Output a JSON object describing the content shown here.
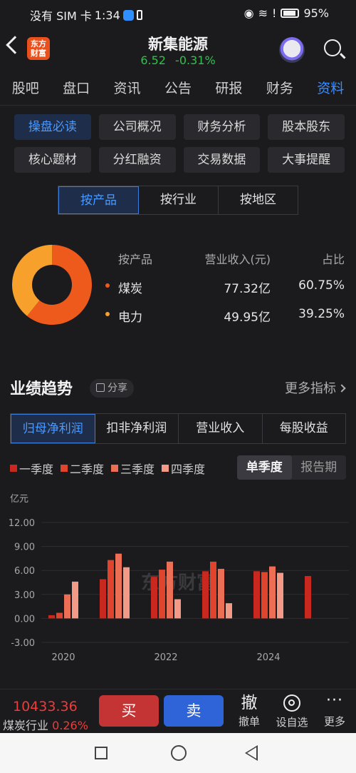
{
  "status": {
    "carrier": "没有 SIM 卡",
    "time": "1:34",
    "battery": "95%"
  },
  "header": {
    "logo_line1": "东方",
    "logo_line2": "财富",
    "stock_name": "新集能源",
    "price": "6.52",
    "change": "-0.31%"
  },
  "main_tabs": [
    "股吧",
    "盘口",
    "资讯",
    "公告",
    "研报",
    "财务",
    "资料"
  ],
  "main_tab_active": "资料",
  "sub_tabs": [
    "操盘必读",
    "公司概况",
    "财务分析",
    "股本股东",
    "核心题材",
    "分红融资",
    "交易数据",
    "大事提醒"
  ],
  "revenue_split": {
    "segments": [
      "按产品",
      "按行业",
      "按地区"
    ],
    "headers": [
      "按产品",
      "营业收入(元)",
      "占比"
    ],
    "rows": [
      {
        "name": "煤炭",
        "revenue": "77.32亿",
        "share": "60.75%",
        "pct": 60.75,
        "color": "#ee5a1c"
      },
      {
        "name": "电力",
        "revenue": "49.95亿",
        "share": "39.25%",
        "pct": 39.25,
        "color": "#f7a12c"
      }
    ]
  },
  "performance": {
    "title": "业绩趋势",
    "share_label": "分享",
    "more_label": "更多指标",
    "tabs": [
      "归母净利润",
      "扣非净利润",
      "营业收入",
      "每股收益"
    ],
    "legend": [
      {
        "label": "一季度",
        "color": "#c8281e"
      },
      {
        "label": "二季度",
        "color": "#e0442c"
      },
      {
        "label": "三季度",
        "color": "#ec6e54"
      },
      {
        "label": "四季度",
        "color": "#f29a86"
      }
    ],
    "toggle": [
      "单季度",
      "报告期"
    ],
    "watermark": "东方财富"
  },
  "chart_data": {
    "type": "bar",
    "ylabel": "亿元",
    "ylim": [
      -3,
      12
    ],
    "yticks": [
      "12.00",
      "9.00",
      "6.00",
      "3.00",
      "0.00",
      "-3.00"
    ],
    "x_tick_labels": [
      "2020",
      "2022",
      "2024"
    ],
    "categories": [
      "2020",
      "2021",
      "2022",
      "2023",
      "2024",
      "2025"
    ],
    "series": [
      {
        "name": "一季度",
        "values": [
          0.4,
          4.9,
          5.2,
          5.9,
          5.9,
          5.3
        ]
      },
      {
        "name": "二季度",
        "values": [
          0.7,
          7.3,
          6.1,
          7.1,
          5.8,
          null
        ]
      },
      {
        "name": "三季度",
        "values": [
          3.0,
          8.1,
          7.1,
          6.2,
          6.5,
          null
        ]
      },
      {
        "name": "四季度",
        "values": [
          4.6,
          6.4,
          2.4,
          1.9,
          5.7,
          null
        ]
      }
    ]
  },
  "bottom": {
    "index_value": "10433.36",
    "index_name": "煤炭行业",
    "index_change": "0.26%",
    "buy": "买",
    "sell": "卖",
    "actions": [
      {
        "glyph": "撤",
        "label": "撤单"
      },
      {
        "label": "设自选"
      },
      {
        "glyph": "···",
        "label": "更多"
      }
    ]
  }
}
